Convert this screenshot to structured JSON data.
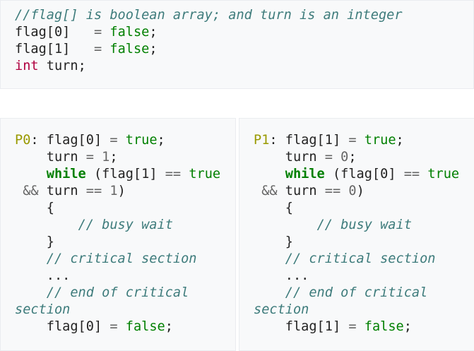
{
  "header_code": {
    "comment": "//flag[] is boolean array; and turn is an integer",
    "flag0": "flag[0]",
    "flag1": "flag[1]",
    "type_int": "int",
    "turn_decl": " turn;",
    "false_value": "false"
  },
  "processes": [
    {
      "label": "P0",
      "own_flag": "flag[0]",
      "other_flag": "flag[1]",
      "turn_value": "1",
      "true_value": "true",
      "false_value": "false",
      "keyword_while": "while",
      "busy_wait_comment": "// busy wait",
      "critical_comment": "// critical section",
      "ellipsis": "...",
      "end_comment_1": "// end of critical",
      "end_comment_2": "section"
    },
    {
      "label": "P1",
      "own_flag": "flag[1]",
      "other_flag": "flag[0]",
      "turn_value": "0",
      "true_value": "true",
      "false_value": "false",
      "keyword_while": "while",
      "busy_wait_comment": "// busy wait",
      "critical_comment": "// critical section",
      "ellipsis": "...",
      "end_comment_1": "// end of critical",
      "end_comment_2": "section"
    }
  ]
}
